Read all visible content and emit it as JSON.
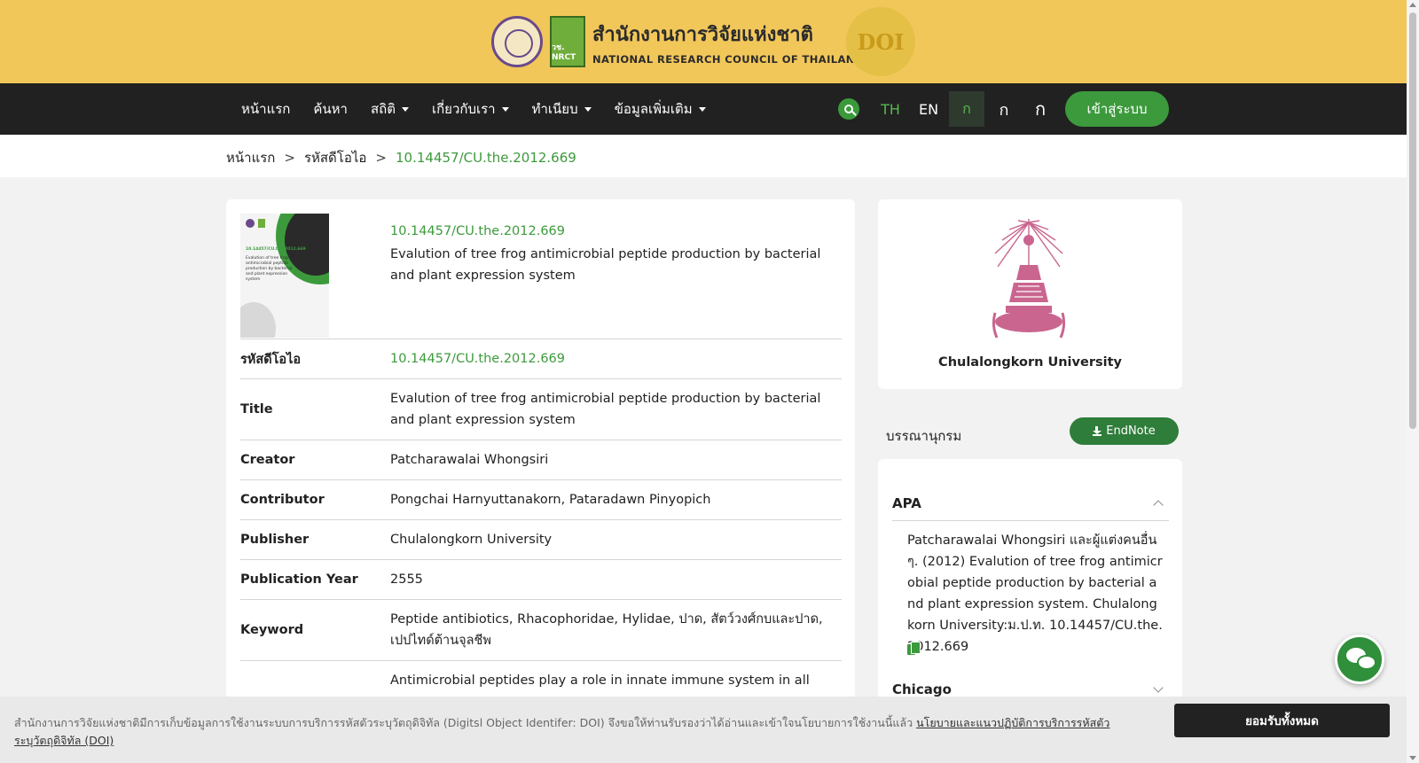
{
  "header": {
    "org_name_th": "สำนักงานการวิจัยแห่งชาติ",
    "org_name_en": "NATIONAL RESEARCH COUNCIL OF THAILAND",
    "nrct_badge": "วช. NRCT",
    "doi_badge": "DOI"
  },
  "nav": {
    "items": [
      {
        "label": "หน้าแรก",
        "dropdown": false
      },
      {
        "label": "ค้นหา",
        "dropdown": false
      },
      {
        "label": "สถิติ",
        "dropdown": true
      },
      {
        "label": "เกี่ยวกับเรา",
        "dropdown": true
      },
      {
        "label": "ทำเนียบ",
        "dropdown": true
      },
      {
        "label": "ข้อมูลเพิ่มเติม",
        "dropdown": true
      }
    ],
    "lang_th": "TH",
    "lang_en": "EN",
    "font_small": "ก",
    "font_medium": "ก",
    "font_large": "ก",
    "login": "เข้าสู่ระบบ"
  },
  "breadcrumb": {
    "home": "หน้าแรก",
    "sep": ">",
    "section": "รหัสดีโอไอ",
    "current": "10.14457/CU.the.2012.669"
  },
  "record": {
    "doi": "10.14457/CU.the.2012.669",
    "title": "Evalution of tree frog antimicrobial peptide production by bacterial and plant expression system",
    "cover_doi": "10.14457/CU.the.2012.669",
    "cover_title": "Evalution of tree frog antimicrobial peptide production by bacterial and plant expression system",
    "fields": [
      {
        "key": "รหัสดีโอไอ",
        "value": "10.14457/CU.the.2012.669",
        "link": true
      },
      {
        "key": "Title",
        "value": "Evalution of tree frog antimicrobial peptide production by bacterial and plant expression system",
        "link": false
      },
      {
        "key": "Creator",
        "value": "Patcharawalai Whongsiri",
        "link": false
      },
      {
        "key": "Contributor",
        "value": "Pongchai Harnyuttanakorn, Pataradawn Pinyopich",
        "link": false
      },
      {
        "key": "Publisher",
        "value": "Chulalongkorn University",
        "link": false
      },
      {
        "key": "Publication Year",
        "value": "2555",
        "link": false
      },
      {
        "key": "Keyword",
        "value": "Peptide antibiotics, Rhacophoridae, Hylidae, ปาด, สัตว์วงศ์กบและปาด, เปปไทด์ต้านจุลชีพ",
        "link": false
      },
      {
        "key": "",
        "value": "Antimicrobial peptides play a role in innate immune system in all",
        "link": false
      }
    ]
  },
  "university": {
    "name": "Chulalongkorn University"
  },
  "bibliography": {
    "heading": "บรรณานุกรม",
    "endnote": "EndNote",
    "apa_label": "APA",
    "apa_text": "Patcharawalai Whongsiri และผู้แต่งคนอื่นๆ. (2012) Evalution of tree frog antimicrobial peptide production by bacterial and plant expression system. Chulalongkorn University:ม.ป.ท. 10.14457/CU.the.2012.669",
    "chicago_label": "Chicago"
  },
  "cookie": {
    "text": "สำนักงานการวิจัยแห่งชาติมีการเก็บข้อมูลการใช้งานระบบการบริการรหัสตัวระบุวัตถุดิจิทัล (Digitsl Object Identifer: DOI) จึงขอให้ท่านรับรองว่าได้อ่านและเข้าใจนโยบายการใช้งานนี้แล้ว",
    "link": "นโยบายและแนวปฏิบัติการบริการรหัสตัวระบุวัตถุดิจิทัล (DOI)",
    "accept": "ยอมรับทั้งหมด"
  },
  "colors": {
    "header_bg": "#f2c75a",
    "nav_bg": "#212121",
    "accent_green": "#3c9a3c",
    "uni_pink": "#c9658f"
  }
}
